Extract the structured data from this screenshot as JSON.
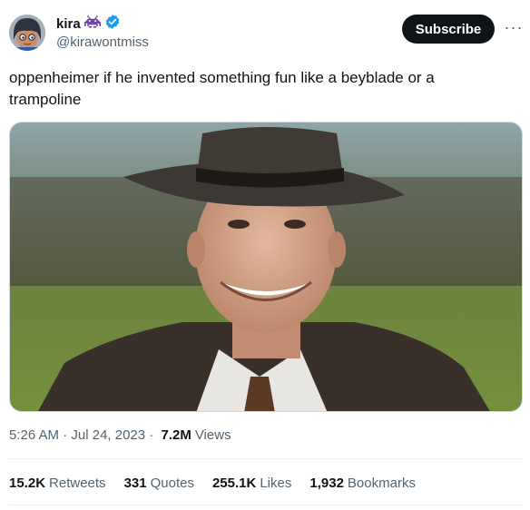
{
  "author": {
    "display_name": "kira",
    "handle": "@kirawontmiss",
    "avatar_icon": "cartoon-avatar-icon",
    "badge_icon": "space-invader-icon",
    "verified_icon": "verified-badge-icon",
    "verified_color": "#1d9bf0"
  },
  "header": {
    "subscribe_label": "Subscribe",
    "more_label": "···"
  },
  "tweet": {
    "text": "oppenheimer if he invented something fun like a beyblade or a trampoline"
  },
  "media": {
    "alt": "man in fedora hat smiling in a field"
  },
  "meta": {
    "time": "5:26 AM",
    "separator": " · ",
    "date": "Jul 24, 2023",
    "views_count": "7.2M",
    "views_label": "Views"
  },
  "stats": [
    {
      "count": "15.2K",
      "label": "Retweets"
    },
    {
      "count": "331",
      "label": "Quotes"
    },
    {
      "count": "255.1K",
      "label": "Likes"
    },
    {
      "count": "1,932",
      "label": "Bookmarks"
    }
  ]
}
